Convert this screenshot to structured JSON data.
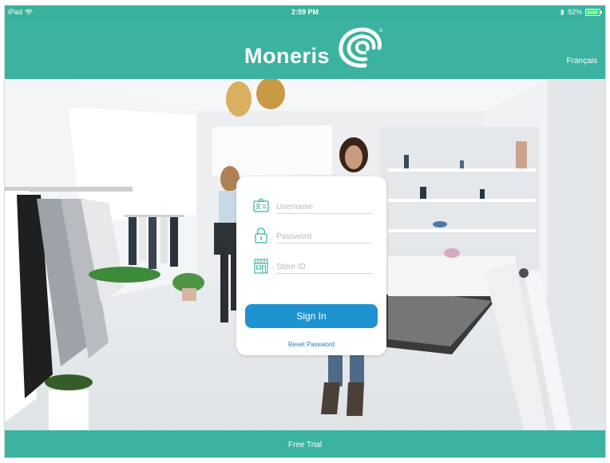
{
  "status_bar": {
    "device": "iPad",
    "time": "2:59 PM",
    "battery": "92%",
    "battery_level": 0.92
  },
  "header": {
    "logo_text": "Moneris",
    "language_link": "Français"
  },
  "login": {
    "username_placeholder": "Username",
    "password_placeholder": "Password",
    "store_id_placeholder": "Store ID",
    "sign_in_label": "Sign In",
    "reset_password_label": "Reset Password"
  },
  "footer": {
    "free_trial_label": "Free Trial"
  },
  "colors": {
    "brand_teal": "#3cb3a0",
    "sign_in_blue": "#1f93cf",
    "link_blue": "#1f7fb8"
  },
  "icons": [
    "wifi-icon",
    "bluetooth-icon",
    "battery-icon",
    "moneris-logo-icon",
    "id-card-icon",
    "lock-icon",
    "store-icon"
  ]
}
